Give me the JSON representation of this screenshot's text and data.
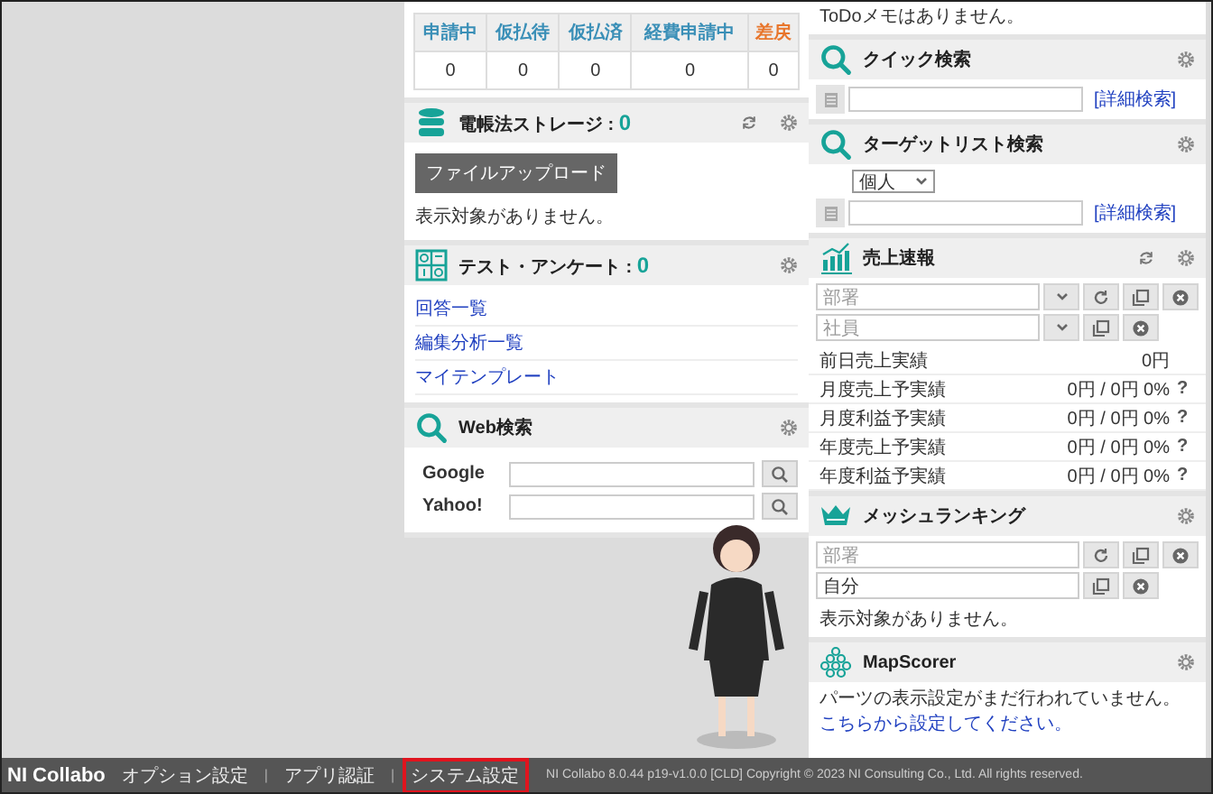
{
  "middle": {
    "status_table": {
      "columns": [
        {
          "label": "申請中",
          "color": "#3a8fb7"
        },
        {
          "label": "仮払待",
          "color": "#3a8fb7"
        },
        {
          "label": "仮払済",
          "color": "#3a8fb7"
        },
        {
          "label": "経費申請中",
          "color": "#3a8fb7"
        },
        {
          "label": "差戻",
          "color": "#e8762c"
        }
      ],
      "values": [
        "0",
        "0",
        "0",
        "0",
        "0"
      ]
    },
    "storage": {
      "title": "電帳法ストレージ",
      "separator": ":",
      "count": "0",
      "button": "ファイルアップロード",
      "empty": "表示対象がありません。"
    },
    "survey": {
      "title": "テスト・アンケート",
      "separator": ":",
      "count": "0",
      "links": [
        "回答一覧",
        "編集分析一覧",
        "マイテンプレート"
      ]
    },
    "web_search": {
      "title": "Web検索",
      "engines": [
        "Google",
        "Yahoo!"
      ]
    }
  },
  "right": {
    "todo_note": "ToDoメモはありません。",
    "quick_search": {
      "title": "クイック検索",
      "link": "[詳細検索]"
    },
    "target_search": {
      "title": "ターゲットリスト検索",
      "select": "個人",
      "link": "[詳細検索]"
    },
    "sales": {
      "title": "売上速報",
      "dept_placeholder": "部署",
      "staff_placeholder": "社員",
      "rows": [
        {
          "label": "前日売上実績",
          "value": "0円"
        },
        {
          "label": "月度売上予実績",
          "value": "0円 / 0円 0%",
          "help": "?"
        },
        {
          "label": "月度利益予実績",
          "value": "0円 / 0円 0%",
          "help": "?"
        },
        {
          "label": "年度売上予実績",
          "value": "0円 / 0円 0%",
          "help": "?"
        },
        {
          "label": "年度利益予実績",
          "value": "0円 / 0円 0%",
          "help": "?"
        }
      ]
    },
    "mesh": {
      "title": "メッシュランキング",
      "dept_placeholder": "部署",
      "staff_value": "自分",
      "empty": "表示対象がありません。"
    },
    "mapscorer": {
      "title": "MapScorer",
      "message": "パーツの表示設定がまだ行われていません。",
      "link": "こちらから設定してください。"
    }
  },
  "footer": {
    "logo": "NI Collabo",
    "separator": "|",
    "links": [
      {
        "label": "オプション設定",
        "selected": false
      },
      {
        "label": "アプリ認証",
        "selected": false
      },
      {
        "label": "システム設定",
        "selected": true
      }
    ],
    "copyright": "NI Collabo 8.0.44 p19-v1.0.0 [CLD] Copyright © 2023 NI Consulting Co., Ltd. All rights reserved."
  }
}
